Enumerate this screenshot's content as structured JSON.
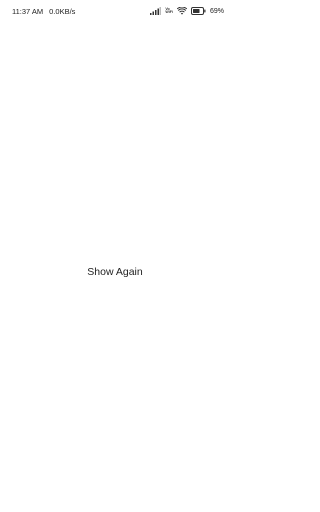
{
  "status_bar": {
    "time": "11:37 AM",
    "network_speed": "0.0KB/s",
    "volte_top": "Vo",
    "volte_bottom": "WiFi",
    "battery_percent": "69",
    "icons": [
      "signal-icon",
      "volte-wifi-icon",
      "wifi-icon",
      "battery-icon"
    ]
  },
  "main": {
    "show_again_label": "Show Again"
  }
}
